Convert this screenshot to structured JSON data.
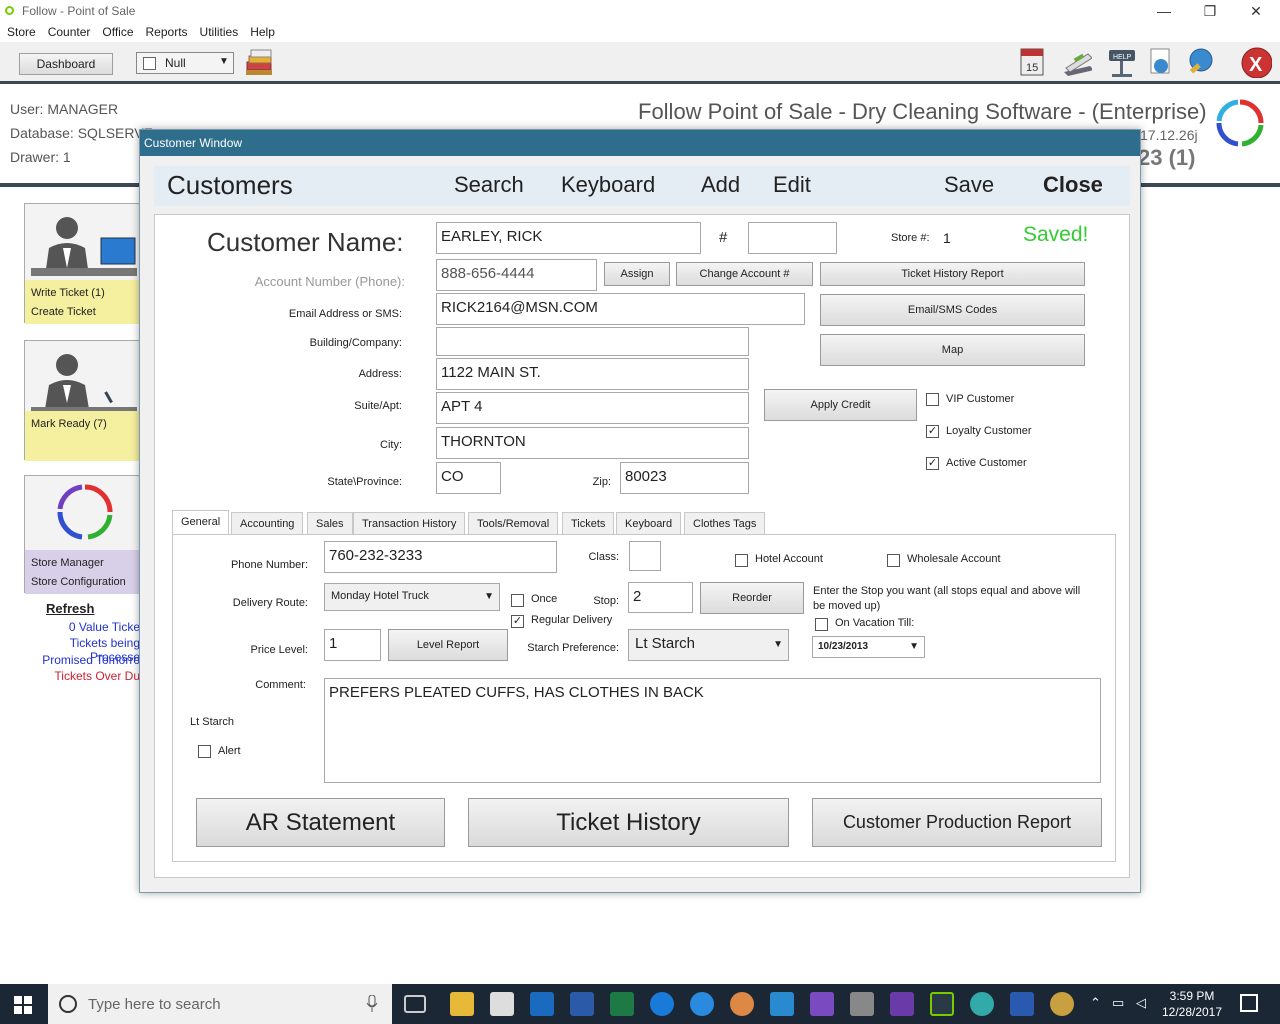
{
  "window": {
    "title": "Follow - Point of Sale",
    "minimize": "—",
    "maximize": "❐",
    "close": "✕"
  },
  "menu": [
    "Store",
    "Counter",
    "Office",
    "Reports",
    "Utilities",
    "Help"
  ],
  "toolbar": {
    "dashboard_label": "Dashboard",
    "null_combo": "Null"
  },
  "header": {
    "user": "User: MANAGER",
    "database": "Database: SQLSERVE",
    "drawer": "Drawer: 1",
    "app_title": "Follow Point of Sale - Dry Cleaning Software - (Enterprise)",
    "version": "17.12.26j",
    "count": "23 (1)"
  },
  "left_panel": {
    "tiles": [
      {
        "line1": "Write Ticket  (1)",
        "line2": "Create Ticket"
      },
      {
        "line1": "Mark Ready (7)",
        "line2": ""
      },
      {
        "line1": "Store Manager",
        "line2": "Store Configuration"
      }
    ],
    "refresh": "Refresh",
    "links": [
      "0 Value Ticke",
      "Tickets being Processe",
      "Promised Tomorro",
      "Tickets Over Du"
    ]
  },
  "customer_window": {
    "title": "Customer Window",
    "bar": {
      "heading": "Customers",
      "search": "Search",
      "keyboard": "Keyboard",
      "add": "Add",
      "edit": "Edit",
      "save": "Save",
      "close": "Close"
    },
    "form": {
      "customer_name_label": "Customer Name:",
      "customer_name": "EARLEY, RICK",
      "hash_label": "#",
      "hash_value": "",
      "store_label": "Store #:",
      "store_value": "1",
      "saved": "Saved!",
      "account_label": "Account Number (Phone):",
      "account_value": "888-656-4444",
      "assign": "Assign",
      "change_account": "Change Account #",
      "ticket_history_report": "Ticket History Report",
      "email_label": "Email Address or SMS:",
      "email_value": "RICK2164@MSN.COM",
      "email_sms_codes": "Email/SMS Codes",
      "building_label": "Building/Company:",
      "building_value": "",
      "map": "Map",
      "address_label": "Address:",
      "address_value": "1122 MAIN ST.",
      "suite_label": "Suite/Apt:",
      "suite_value": "APT 4",
      "apply_credit": "Apply Credit",
      "vip": "VIP Customer",
      "loyalty": "Loyalty Customer",
      "active": "Active Customer",
      "city_label": "City:",
      "city_value": "THORNTON",
      "state_label": "State\\Province:",
      "state_value": "CO",
      "zip_label": "Zip:",
      "zip_value": "80023"
    },
    "tabs": [
      "General",
      "Accounting",
      "Sales",
      "Transaction History",
      "Tools/Removal",
      "Tickets",
      "Keyboard",
      "Clothes Tags"
    ],
    "general": {
      "phone_label": "Phone Number:",
      "phone_value": "760-232-3233",
      "class_label": "Class:",
      "hotel": "Hotel Account",
      "wholesale": "Wholesale Account",
      "route_label": "Delivery Route:",
      "route_value": "Monday Hotel Truck",
      "once": "Once",
      "regular": "Regular Delivery",
      "stop_label": "Stop:",
      "stop_value": "2",
      "reorder": "Reorder",
      "stop_note": "Enter the Stop you want (all stops equal and above will be moved up)",
      "vacation": "On Vacation Till:",
      "vacation_date": "10/23/2013",
      "price_label": "Price Level:",
      "price_value": "1",
      "level_report": "Level Report",
      "starch_label": "Starch Preference:",
      "starch_value": "Lt Starch",
      "comment_label": "Comment:",
      "comment_value": "PREFERS PLEATED CUFFS, HAS CLOTHES IN BACK",
      "lt_starch": "Lt Starch",
      "alert": "Alert",
      "ar_statement": "AR Statement",
      "ticket_history": "Ticket History",
      "production_report": "Customer Production Report"
    }
  },
  "taskbar": {
    "search_placeholder": "Type here to search",
    "time": "3:59 PM",
    "date": "12/28/2017"
  }
}
